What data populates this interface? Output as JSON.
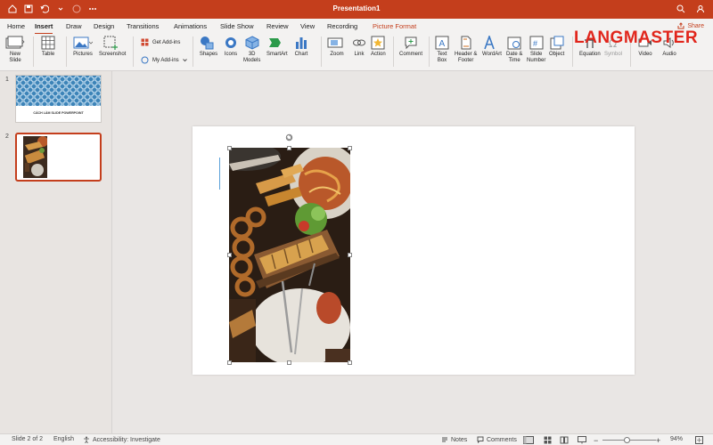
{
  "titlebar": {
    "title": "Presentation1"
  },
  "tabs": [
    {
      "label": "Home"
    },
    {
      "label": "Insert"
    },
    {
      "label": "Draw"
    },
    {
      "label": "Design"
    },
    {
      "label": "Transitions"
    },
    {
      "label": "Animations"
    },
    {
      "label": "Slide Show"
    },
    {
      "label": "Review"
    },
    {
      "label": "View"
    },
    {
      "label": "Recording"
    },
    {
      "label": "Picture Format"
    }
  ],
  "share_label": "Share",
  "ribbon": {
    "new_slide": "New\nSlide",
    "table": "Table",
    "pictures": "Pictures",
    "screenshot": "Screenshot",
    "get_addins": "Get Add-ins",
    "my_addins": "My Add-ins",
    "shapes": "Shapes",
    "icons": "Icons",
    "models": "3D\nModels",
    "smartart": "SmartArt",
    "chart": "Chart",
    "zoom": "Zoom",
    "link": "Link",
    "action": "Action",
    "comment": "Comment",
    "textbox": "Text\nBox",
    "header_footer": "Header &\nFooter",
    "wordart": "WordArt",
    "datetime": "Date &\nTime",
    "slide_number": "Slide\nNumber",
    "object": "Object",
    "equation": "Equation",
    "symbol": "Symbol",
    "video": "Video",
    "audio": "Audio"
  },
  "watermark": "LANGMASTER",
  "slides": [
    {
      "number": "1",
      "title_text": "CÁCH LÀM SLIDE POWERPOINT"
    },
    {
      "number": "2"
    }
  ],
  "status": {
    "slide_indicator": "Slide 2 of 2",
    "language": "English",
    "accessibility": "Accessibility: Investigate",
    "notes": "Notes",
    "comments": "Comments",
    "zoom_level": "94%"
  },
  "colors": {
    "accent": "#c43e1c",
    "brand_logo": "#e1261c"
  }
}
